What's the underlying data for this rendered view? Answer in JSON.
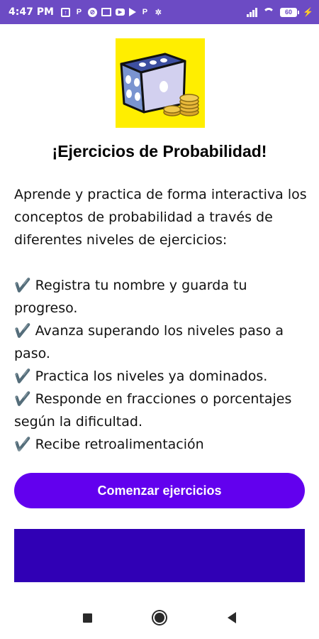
{
  "status_bar": {
    "time": "4:47 PM",
    "notification_icons": [
      "t-icon",
      "p-icon",
      "circle-slash-icon",
      "mail-icon",
      "youtube-icon",
      "play-icon",
      "p-icon",
      "gear-icon"
    ],
    "battery_level": "60",
    "background_color": "#6c4bc4"
  },
  "logo": {
    "icon": "dice-and-coins-icon",
    "background_color": "#ffee00"
  },
  "title": "¡Ejercicios de Probabilidad!",
  "description": {
    "intro": "Aprende y practica de forma interactiva los conceptos de probabilidad a través de diferentes niveles de ejercicios:",
    "check_mark": "✔️",
    "features": [
      "Registra tu nombre y guarda tu progreso.",
      "Avanza superando los niveles paso a paso.",
      "Practica los niveles ya dominados.",
      "Responde en fracciones o porcentajes según la dificultad.",
      "Recibe retroalimentación"
    ]
  },
  "start_button": {
    "label": "Comenzar ejercicios",
    "color": "#6200ee"
  },
  "ad_banner": {
    "color": "#3000b5"
  },
  "navigation": {
    "icons": [
      "recents-icon",
      "home-icon",
      "back-icon"
    ]
  }
}
